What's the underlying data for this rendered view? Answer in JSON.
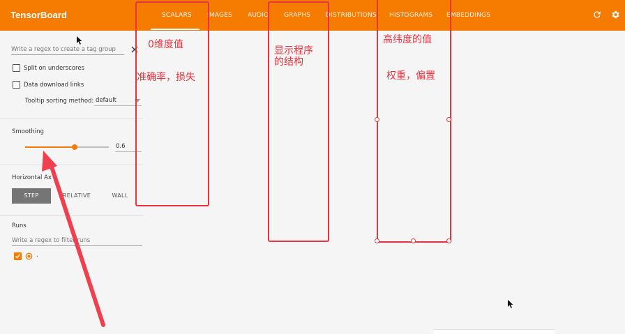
{
  "header": {
    "brand": "TensorBoard",
    "tabs": [
      "SCALARS",
      "IMAGES",
      "AUDIO",
      "GRAPHS",
      "DISTRIBUTIONS",
      "HISTOGRAMS",
      "EMBEDDINGS"
    ],
    "active_tab": "SCALARS",
    "icons": [
      "refresh-icon",
      "settings-icon"
    ]
  },
  "sidebar": {
    "tag_regex_placeholder": "Write a regex to create a tag group",
    "split_label": "Split on underscores",
    "download_label": "Data download links",
    "tooltip_label": "Tooltip sorting method:",
    "tooltip_value": "default",
    "smoothing_title": "Smoothing",
    "smoothing_value": "0.6",
    "smoothing_fraction": 0.6,
    "axis_title": "Horizontal Ax",
    "axis_options": [
      "STEP",
      "RELATIVE",
      "WALL"
    ],
    "axis_selected": "STEP",
    "runs_title": "Runs",
    "runs_placeholder": "Write a regex to filter runs",
    "run_name": "."
  },
  "annotations": {
    "scalars_1": "0维度值",
    "scalars_2": "准确率，损失",
    "graphs_1": "显示程序",
    "graphs_2": "的结构",
    "hist_1": "高纬度的值",
    "hist_2": "权重，偏置"
  },
  "colors": {
    "brand": "#f57c00",
    "annotation": "#e8343f"
  }
}
